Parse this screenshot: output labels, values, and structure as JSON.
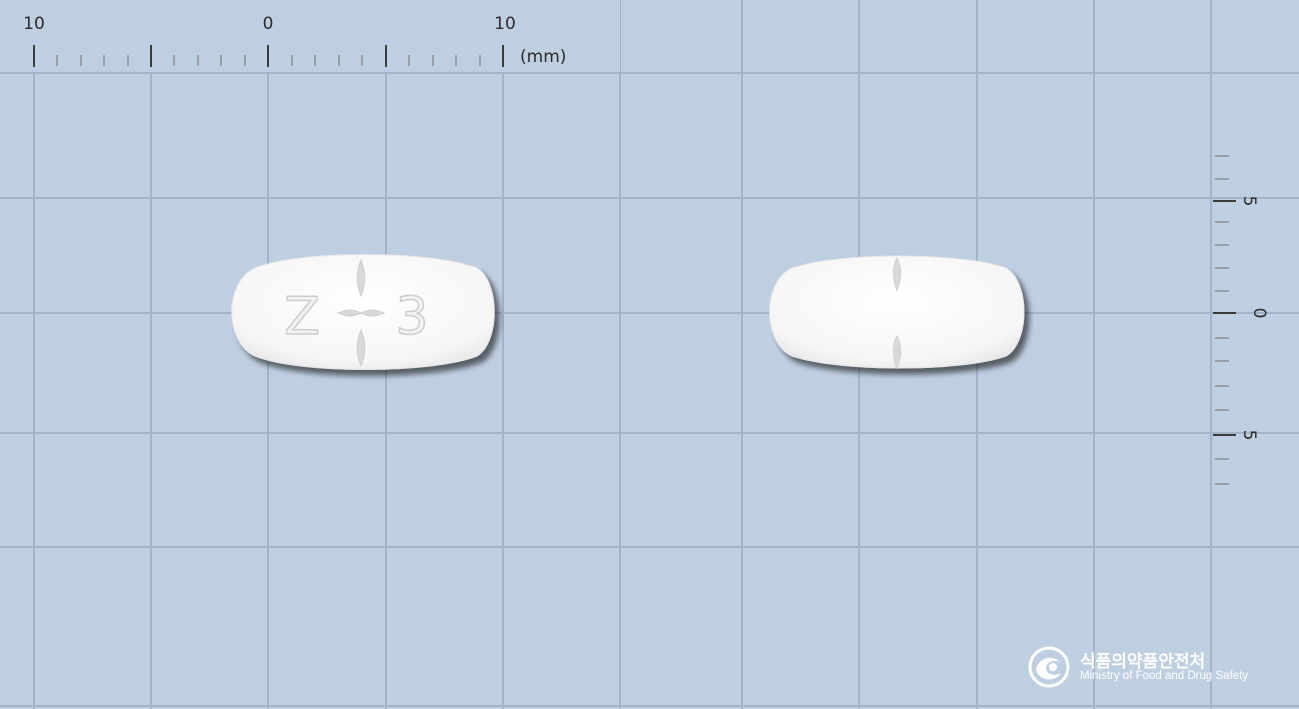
{
  "scale_top": {
    "labels": [
      "10",
      "0",
      "10"
    ],
    "unit": "(mm)"
  },
  "scale_right": {
    "labels": [
      "5",
      "0",
      "5"
    ]
  },
  "tablets": [
    {
      "name": "front",
      "imprint_left": "Z",
      "imprint_right": "3",
      "color": "#f7f7f7"
    },
    {
      "name": "back",
      "imprint_left": "",
      "imprint_right": "",
      "color": "#f7f7f7"
    }
  ],
  "logo": {
    "korean": "식품의약품안전처",
    "english": "Ministry of Food and Drug Safety"
  },
  "colors": {
    "background": "#bfcfe2",
    "grid": "#9fb1c7",
    "tablet": "#f7f7f7"
  }
}
